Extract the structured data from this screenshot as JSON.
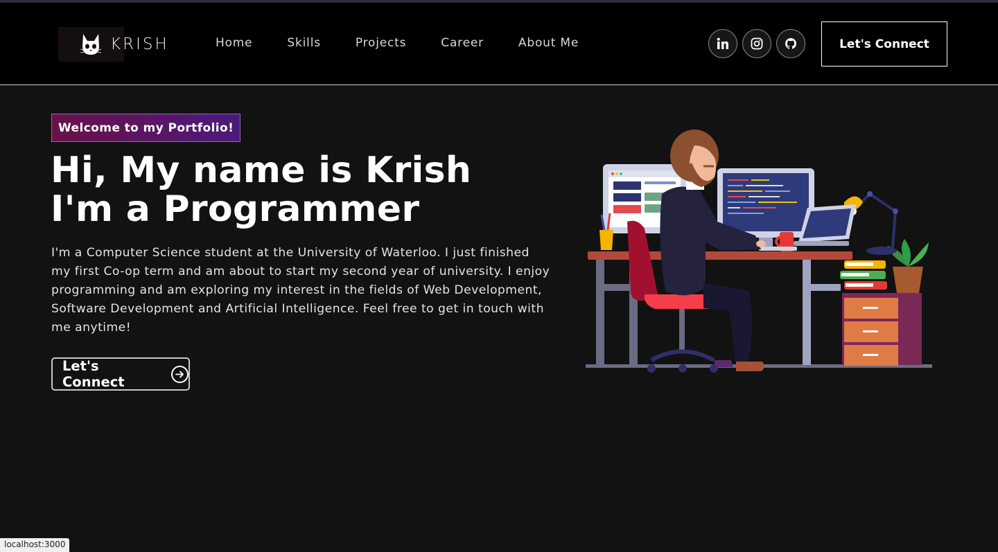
{
  "brand": {
    "name": "KRISH",
    "logo_icon": "cat-face-icon"
  },
  "nav": {
    "links": [
      "Home",
      "Skills",
      "Projects",
      "Career",
      "About Me"
    ],
    "socials": [
      "linkedin-icon",
      "instagram-icon",
      "github-icon"
    ],
    "connect_label": "Let's Connect"
  },
  "hero": {
    "tagline": "Welcome to my Portfolio!",
    "headline_line1": "Hi, My name is Krish",
    "headline_line2": "I'm a Programmer",
    "bio": "I'm a Computer Science student at the University of Waterloo. I just finished my first Co-op term and am about to start my second year of university. I enjoy programming and am exploring my interest in the fields of Web Development, Software Development and Artificial Intelligence. Feel free to get in touch with me anytime!",
    "connect_label": "Let's Connect",
    "connect_icon": "arrow-right-circle-icon",
    "illustration": "programmer-at-desk-illustration"
  },
  "status_bar": {
    "url": "localhost:3000"
  },
  "colors": {
    "background": "#121212",
    "navbar": "#000000",
    "tag_gradient_start": "#6a1148",
    "tag_gradient_end": "#4b1a7c"
  }
}
